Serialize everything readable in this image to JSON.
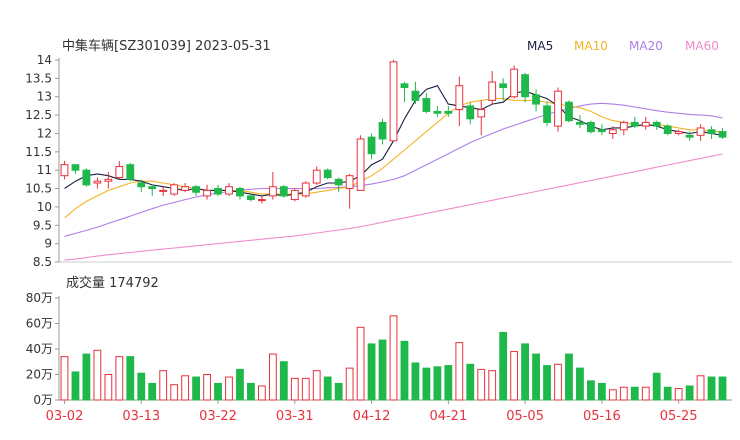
{
  "colors": {
    "up": "#e8323c",
    "down": "#1fb84a",
    "ma5": "#1a2140",
    "ma10": "#f5b325",
    "ma20": "#b07ee6",
    "ma60": "#f08ccc",
    "axis": "#999999",
    "text": "#333333",
    "date": "#e8323c"
  },
  "chart_data": [
    {
      "type": "candlestick",
      "title": "中集车辆[SZ301039] 2023-05-31",
      "legend": [
        "MA5",
        "MA10",
        "MA20",
        "MA60"
      ],
      "legend_position": "top-right",
      "ylim": [
        8.5,
        14
      ],
      "y_ticks": [
        "14",
        "13.5",
        "13",
        "12.5",
        "12",
        "11.5",
        "11",
        "10.5",
        "10",
        "9.5",
        "9",
        "8.5"
      ],
      "x_ticks": [
        {
          "label": "03-02",
          "index": 0
        },
        {
          "label": "03-13",
          "index": 7
        },
        {
          "label": "03-22",
          "index": 14
        },
        {
          "label": "03-31",
          "index": 21
        },
        {
          "label": "04-12",
          "index": 28
        },
        {
          "label": "04-21",
          "index": 35
        },
        {
          "label": "05-05",
          "index": 42
        },
        {
          "label": "05-16",
          "index": 49
        },
        {
          "label": "05-25",
          "index": 56
        }
      ],
      "ohlc": [
        [
          10.85,
          11.15,
          11.25,
          10.75
        ],
        [
          11.15,
          11.0,
          11.15,
          10.9
        ],
        [
          11.0,
          10.6,
          11.05,
          10.55
        ],
        [
          10.65,
          10.7,
          10.8,
          10.5
        ],
        [
          10.7,
          10.75,
          10.95,
          10.5
        ],
        [
          10.8,
          11.1,
          11.25,
          10.75
        ],
        [
          11.15,
          10.75,
          11.2,
          10.7
        ],
        [
          10.65,
          10.55,
          10.75,
          10.4
        ],
        [
          10.55,
          10.5,
          10.6,
          10.3
        ],
        [
          10.45,
          10.45,
          10.55,
          10.3
        ],
        [
          10.35,
          10.6,
          10.65,
          10.3
        ],
        [
          10.45,
          10.55,
          10.65,
          10.4
        ],
        [
          10.55,
          10.4,
          10.6,
          10.3
        ],
        [
          10.3,
          10.45,
          10.6,
          10.2
        ],
        [
          10.5,
          10.35,
          10.6,
          10.3
        ],
        [
          10.35,
          10.55,
          10.65,
          10.3
        ],
        [
          10.5,
          10.3,
          10.55,
          10.2
        ],
        [
          10.3,
          10.2,
          10.35,
          10.15
        ],
        [
          10.2,
          10.2,
          10.3,
          10.1
        ],
        [
          10.3,
          10.55,
          10.95,
          10.2
        ],
        [
          10.55,
          10.3,
          10.6,
          10.25
        ],
        [
          10.2,
          10.45,
          10.5,
          10.15
        ],
        [
          10.3,
          10.65,
          10.7,
          10.25
        ],
        [
          10.65,
          11.0,
          11.1,
          10.6
        ],
        [
          11.0,
          10.8,
          11.05,
          10.75
        ],
        [
          10.75,
          10.6,
          10.8,
          10.4
        ],
        [
          10.5,
          10.85,
          10.9,
          9.95
        ],
        [
          10.45,
          11.85,
          11.95,
          10.45
        ],
        [
          11.9,
          11.45,
          12.0,
          11.3
        ],
        [
          12.3,
          11.85,
          12.4,
          11.7
        ],
        [
          11.8,
          13.95,
          14.0,
          11.8
        ],
        [
          13.35,
          13.25,
          13.4,
          12.85
        ],
        [
          13.15,
          12.9,
          13.4,
          12.8
        ],
        [
          12.95,
          12.6,
          13.1,
          12.55
        ],
        [
          12.6,
          12.55,
          12.75,
          12.45
        ],
        [
          12.6,
          12.55,
          12.75,
          12.45
        ],
        [
          12.65,
          13.3,
          13.55,
          12.2
        ],
        [
          12.75,
          12.4,
          12.85,
          12.25
        ],
        [
          12.45,
          12.65,
          12.9,
          11.95
        ],
        [
          12.9,
          13.4,
          13.7,
          12.8
        ],
        [
          13.35,
          13.25,
          13.5,
          12.9
        ],
        [
          13.0,
          13.75,
          13.85,
          12.95
        ],
        [
          13.6,
          13.0,
          13.65,
          12.85
        ],
        [
          13.05,
          12.8,
          13.2,
          12.6
        ],
        [
          12.75,
          12.3,
          12.85,
          12.2
        ],
        [
          12.2,
          13.15,
          13.25,
          12.05
        ],
        [
          12.85,
          12.35,
          12.9,
          12.3
        ],
        [
          12.3,
          12.25,
          12.5,
          12.15
        ],
        [
          12.3,
          12.05,
          12.35,
          12.0
        ],
        [
          12.1,
          12.05,
          12.25,
          11.95
        ],
        [
          12.0,
          12.1,
          12.2,
          11.85
        ],
        [
          12.1,
          12.3,
          12.35,
          11.95
        ],
        [
          12.3,
          12.2,
          12.45,
          12.15
        ],
        [
          12.2,
          12.3,
          12.45,
          12.1
        ],
        [
          12.3,
          12.2,
          12.35,
          12.1
        ],
        [
          12.2,
          12.0,
          12.25,
          11.95
        ],
        [
          12.0,
          12.05,
          12.1,
          11.95
        ],
        [
          11.95,
          11.9,
          12.05,
          11.8
        ],
        [
          11.95,
          12.15,
          12.25,
          11.8
        ],
        [
          12.1,
          12.0,
          12.2,
          11.85
        ],
        [
          12.05,
          11.9,
          12.15,
          11.85
        ]
      ],
      "ma": {
        "MA5": [
          10.5,
          10.7,
          10.85,
          10.9,
          10.85,
          10.75,
          10.75,
          10.7,
          10.6,
          10.55,
          10.5,
          10.45,
          10.5,
          10.45,
          10.45,
          10.45,
          10.4,
          10.35,
          10.3,
          10.35,
          10.3,
          10.35,
          10.4,
          10.55,
          10.65,
          10.65,
          10.7,
          10.85,
          11.15,
          11.3,
          11.8,
          12.4,
          12.9,
          13.2,
          13.3,
          12.8,
          12.75,
          12.7,
          12.65,
          12.8,
          12.85,
          13.1,
          13.15,
          13.05,
          12.95,
          12.75,
          12.45,
          12.35,
          12.2,
          12.1,
          12.15,
          12.15,
          12.2,
          12.25,
          12.2,
          12.1,
          12.05,
          12.0,
          12.05,
          12.0,
          11.95
        ],
        "MA10": [
          9.7,
          9.95,
          10.15,
          10.3,
          10.45,
          10.55,
          10.65,
          10.7,
          10.7,
          10.65,
          10.6,
          10.55,
          10.5,
          10.45,
          10.45,
          10.45,
          10.45,
          10.4,
          10.35,
          10.35,
          10.35,
          10.35,
          10.35,
          10.4,
          10.45,
          10.5,
          10.55,
          10.7,
          10.85,
          11.05,
          11.3,
          11.55,
          11.8,
          12.05,
          12.3,
          12.55,
          12.75,
          12.85,
          12.9,
          12.95,
          12.95,
          12.9,
          12.9,
          12.9,
          12.85,
          12.8,
          12.75,
          12.7,
          12.6,
          12.45,
          12.35,
          12.3,
          12.25,
          12.2,
          12.25,
          12.2,
          12.15,
          12.1,
          12.1,
          12.05,
          12.05
        ],
        "MA20": [
          9.2,
          9.28,
          9.36,
          9.45,
          9.55,
          9.65,
          9.75,
          9.85,
          9.95,
          10.05,
          10.12,
          10.2,
          10.27,
          10.33,
          10.38,
          10.42,
          10.46,
          10.48,
          10.5,
          10.5,
          10.5,
          10.5,
          10.5,
          10.5,
          10.52,
          10.53,
          10.55,
          10.58,
          10.62,
          10.68,
          10.75,
          10.85,
          11.0,
          11.15,
          11.3,
          11.45,
          11.6,
          11.75,
          11.88,
          12.0,
          12.12,
          12.22,
          12.32,
          12.42,
          12.52,
          12.6,
          12.68,
          12.75,
          12.8,
          12.82,
          12.8,
          12.77,
          12.72,
          12.67,
          12.62,
          12.58,
          12.55,
          12.52,
          12.5,
          12.48,
          12.42
        ],
        "MA60": [
          8.55,
          8.58,
          8.62,
          8.66,
          8.7,
          8.73,
          8.76,
          8.79,
          8.82,
          8.85,
          8.88,
          8.91,
          8.94,
          8.97,
          9.0,
          9.03,
          9.06,
          9.09,
          9.12,
          9.15,
          9.18,
          9.21,
          9.25,
          9.29,
          9.33,
          9.37,
          9.41,
          9.46,
          9.52,
          9.58,
          9.64,
          9.7,
          9.76,
          9.82,
          9.88,
          9.94,
          10.0,
          10.06,
          10.12,
          10.18,
          10.24,
          10.3,
          10.36,
          10.42,
          10.48,
          10.54,
          10.6,
          10.66,
          10.72,
          10.78,
          10.84,
          10.9,
          10.96,
          11.02,
          11.08,
          11.14,
          11.2,
          11.26,
          11.32,
          11.38,
          11.44
        ]
      }
    },
    {
      "type": "bar",
      "title": "成交量 174792",
      "ylim": [
        0,
        80
      ],
      "y_ticks": [
        "80万",
        "60万",
        "40万",
        "20万",
        "0万"
      ],
      "unit": "万",
      "values": [
        34,
        22,
        36,
        39,
        20,
        34,
        34,
        21,
        13,
        23,
        12,
        19,
        18,
        20,
        13,
        18,
        24,
        13,
        11,
        36,
        30,
        17,
        17,
        23,
        18,
        13,
        25,
        57,
        44,
        47,
        66,
        46,
        29,
        25,
        26,
        27,
        45,
        28,
        24,
        23,
        53,
        38,
        44,
        36,
        27,
        28,
        36,
        25,
        15,
        13,
        8,
        10,
        10,
        10,
        21,
        10,
        9,
        11,
        19,
        18,
        18
      ]
    }
  ]
}
